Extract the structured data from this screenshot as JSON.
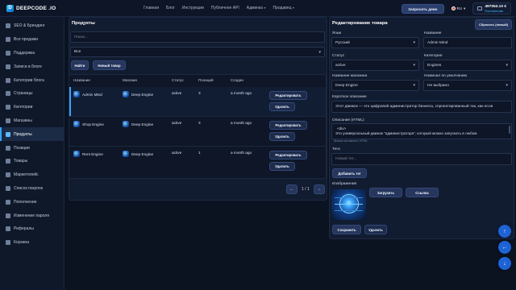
{
  "brand": {
    "name": "DEEPCODE .IO"
  },
  "topnav": {
    "items": [
      "Главная",
      "Блог",
      "Инструкции",
      "Публичное API",
      "Админка",
      "Продавец"
    ]
  },
  "header": {
    "support_label": "Запросить демо",
    "lang": "RU",
    "balance": "497053.10 €",
    "replenish": "Пополнение"
  },
  "sidebar": {
    "items": [
      {
        "label": "SEO & Брендинг",
        "icon": "megaphone-icon"
      },
      {
        "label": "Все продажи",
        "icon": "cart-icon"
      },
      {
        "label": "Поддержка",
        "icon": "support-icon"
      },
      {
        "label": "Записи в блоге",
        "icon": "pen-icon"
      },
      {
        "label": "Категории блога",
        "icon": "folder-icon"
      },
      {
        "label": "Страницы",
        "icon": "page-icon"
      },
      {
        "label": "Категории",
        "icon": "tag-icon"
      },
      {
        "label": "Магазины",
        "icon": "store-icon"
      },
      {
        "label": "Продукты",
        "icon": "box-icon"
      },
      {
        "label": "Позиции",
        "icon": "list-icon"
      },
      {
        "label": "Товары",
        "icon": "goods-icon"
      },
      {
        "label": "Маркетплейс",
        "icon": "market-icon"
      },
      {
        "label": "Список покупок",
        "icon": "checklist-icon"
      },
      {
        "label": "Пополнение",
        "icon": "wallet-icon"
      },
      {
        "label": "Изменение пароля",
        "icon": "key-icon"
      },
      {
        "label": "Рефералы",
        "icon": "users-icon"
      },
      {
        "label": "Корзина",
        "icon": "basket-icon"
      }
    ],
    "active_index": 8
  },
  "products": {
    "title": "Продукты",
    "search_placeholder": "Поиск...",
    "filter_value": "Все",
    "find_label": "Найти",
    "new_label": "Новый товар",
    "columns": [
      "Название",
      "Магазин",
      "Статус",
      "Позиций",
      "Создан"
    ],
    "rows": [
      {
        "name": "Admin Mind",
        "store": "Deep Engine",
        "status": "active",
        "positions": "3",
        "created": "a month ago"
      },
      {
        "name": "Shop Engine",
        "store": "Deep Engine",
        "status": "active",
        "positions": "3",
        "created": "a month ago"
      },
      {
        "name": "Rent Engine",
        "store": "Deep Engine",
        "status": "active",
        "positions": "1",
        "created": "a month ago"
      }
    ],
    "edit_label": "Редактировать",
    "delete_label": "Удалить",
    "pager": {
      "prev": "←",
      "page": "1 / 1",
      "next": "→"
    }
  },
  "editor": {
    "title": "Редактирование товара",
    "reset_label": "Сбросить (новый)",
    "language_label": "Язык",
    "language_value": "Русский",
    "name_label": "Название",
    "name_value": "Admin Mind",
    "status_label": "Статус",
    "status_value": "active",
    "category_label": "Категория",
    "category_value": "Engines",
    "store_label": "Название магазина",
    "store_value": "Deep Engine",
    "nominal_label": "Номинал по умолчанию",
    "nominal_value": "Не выбрано",
    "short_label": "Короткое описание",
    "short_value": "Этот движок — это цифровой администратор бизнеса, спроектированный так, как если",
    "html_label": "Описание (HTML)",
    "html_line1": "<div>",
    "html_line2": "Это универсальный движок \"администратора\", который можно запускать в любом",
    "html_hint": "Можно вставлять HTML",
    "tags_label": "Теги",
    "tags_placeholder": "Новый тег...",
    "add_tag_label": "Добавить тег",
    "images_label": "Изображения",
    "upload_label": "Загрузить",
    "link_label": "Ссылка",
    "save_label": "Сохранить",
    "delete_label": "Удалить"
  },
  "fabs": {
    "up": "↑",
    "back": "←",
    "down": "↓"
  }
}
